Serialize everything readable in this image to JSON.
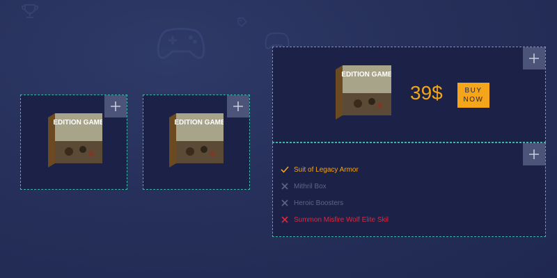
{
  "colors": {
    "accent": "#f5a51a",
    "included": "#f5a51a",
    "excluded": "#5f6684",
    "highlight": "#e0283c",
    "border": "#3fb6a8",
    "card_bg": "#1b2147",
    "plus_bg": "#4c5479"
  },
  "cards": {
    "left": {
      "add_icon": "plus-icon",
      "image_title": "EDITION GAME"
    },
    "middle": {
      "add_icon": "plus-icon",
      "image_title": "EDITION GAME"
    },
    "product": {
      "add_icon": "plus-icon",
      "image_title": "EDITION GAME",
      "price": "39$",
      "buy_label": "BUY NOW"
    },
    "features": {
      "add_icon": "plus-icon",
      "items": [
        {
          "label": "Suit of Legacy Armor",
          "status": "included",
          "icon": "check-icon"
        },
        {
          "label": "Mithril Box",
          "status": "excluded",
          "icon": "cross-icon"
        },
        {
          "label": "Heroic Boosters",
          "status": "excluded",
          "icon": "cross-icon"
        },
        {
          "label": "Summon Misfire Wolf Elite Skil",
          "status": "highlight",
          "icon": "cross-icon"
        }
      ]
    }
  }
}
